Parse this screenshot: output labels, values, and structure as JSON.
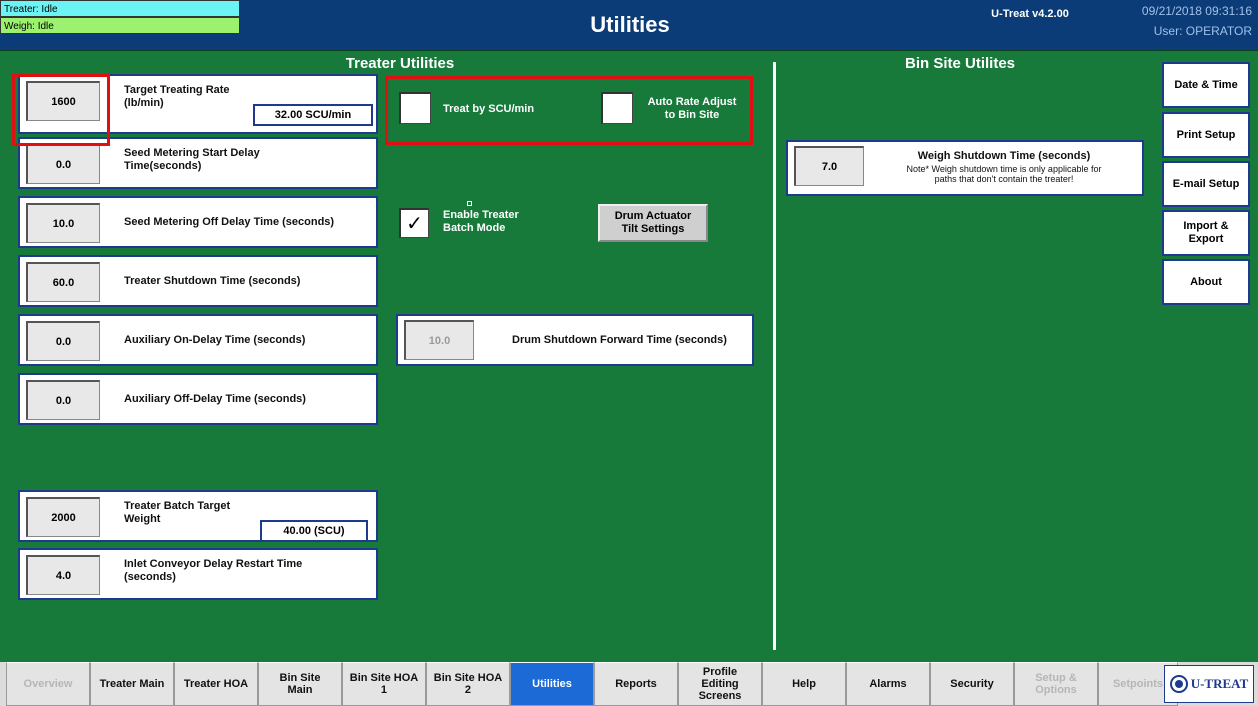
{
  "header": {
    "treater_status": "Treater: Idle",
    "weigh_status": "Weigh: Idle",
    "title": "Utilities",
    "version": "U-Treat v4.2.00",
    "datetime": "09/21/2018 09:31:16",
    "user": "User: OPERATOR"
  },
  "treater_utilities": {
    "title": "Treater Utilities",
    "rows": [
      {
        "value": "1600",
        "label": "Target Treating Rate\n(lb/min)",
        "unit": "32.00  SCU/min"
      },
      {
        "value": "0.0",
        "label": "Seed Metering Start Delay\nTime(seconds)"
      },
      {
        "value": "10.0",
        "label": "Seed Metering Off Delay Time (seconds)"
      },
      {
        "value": "60.0",
        "label": "Treater Shutdown Time (seconds)"
      },
      {
        "value": "0.0",
        "label": "Auxiliary On-Delay Time (seconds)"
      },
      {
        "value": "0.0",
        "label": "Auxiliary Off-Delay Time (seconds)"
      },
      {
        "value": "2000",
        "label": "Treater Batch Target\nWeight",
        "unit": "40.00  (SCU)"
      },
      {
        "value": "4.0",
        "label": "Inlet Conveyor Delay Restart Time\n(seconds)"
      }
    ],
    "treat_by_scu_label": "Treat by SCU/min",
    "auto_rate_label": "Auto Rate Adjust\nto Bin Site",
    "enable_batch_label": "Enable Treater\nBatch Mode",
    "enable_batch_checked": true,
    "drum_actuator_label": "Drum Actuator\nTilt Settings",
    "drum_shutdown_value": "10.0",
    "drum_shutdown_label": "Drum Shutdown Forward Time (seconds)"
  },
  "bin_site": {
    "title": "Bin Site Utilites",
    "weigh_value": "7.0",
    "weigh_label": "Weigh Shutdown Time (seconds)",
    "weigh_note": "Note*  Weigh shutdown time is only applicable for\npaths that don't contain the treater!"
  },
  "side_buttons": [
    "Date & Time",
    "Print Setup",
    "E-mail Setup",
    "Import &\nExport",
    "About"
  ],
  "tabs": [
    {
      "label": "Overview",
      "state": "dim"
    },
    {
      "label": "Treater Main",
      "state": "normal"
    },
    {
      "label": "Treater HOA",
      "state": "normal"
    },
    {
      "label": "Bin Site\nMain",
      "state": "normal"
    },
    {
      "label": "Bin Site HOA\n1",
      "state": "normal"
    },
    {
      "label": "Bin Site HOA\n2",
      "state": "normal"
    },
    {
      "label": "Utilities",
      "state": "active"
    },
    {
      "label": "Reports",
      "state": "normal"
    },
    {
      "label": "Profile\nEditing\nScreens",
      "state": "normal"
    },
    {
      "label": "Help",
      "state": "normal"
    },
    {
      "label": "Alarms",
      "state": "normal"
    },
    {
      "label": "Security",
      "state": "normal"
    },
    {
      "label": "Setup &\nOptions",
      "state": "dim"
    },
    {
      "label": "Setpoints",
      "state": "dim"
    }
  ],
  "logo_text": "U-TREAT",
  "colors": {
    "header": "#0c3c78",
    "background": "#177a3a",
    "accent": "#1b6ad6",
    "highlight": "#e01010"
  }
}
